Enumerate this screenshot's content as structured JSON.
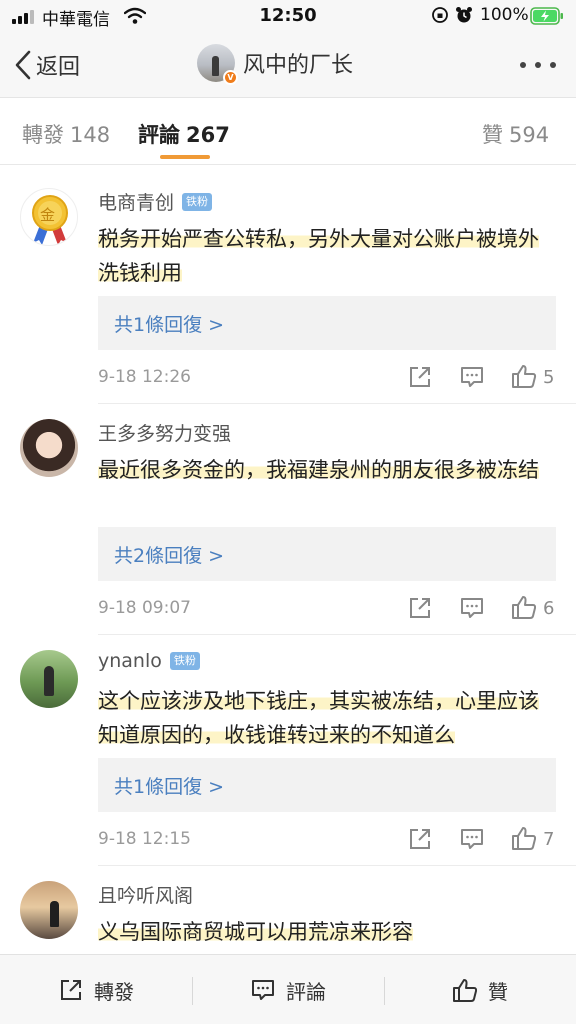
{
  "status_bar": {
    "carrier": "中華電信",
    "time": "12:50",
    "battery": "100%"
  },
  "nav": {
    "back_label": "返回",
    "title": "风中的厂长",
    "verified_mark": "V"
  },
  "tabs": [
    {
      "label": "轉發",
      "count": "148"
    },
    {
      "label": "評論",
      "count": "267"
    },
    {
      "label": "贊",
      "count": "594"
    }
  ],
  "comments": [
    {
      "author": "电商青创",
      "badge": "铁粉",
      "avatar_text": "金",
      "text": "税务开始严查公转私，另外大量对公账户被境外洗钱利用",
      "replies": "共1條回復 >",
      "time": "9-18 12:26",
      "likes": "5"
    },
    {
      "author": "王多多努力变强",
      "badge": "",
      "text": "最近很多资金的，我福建泉州的朋友很多被冻结",
      "replies": "共2條回復 >",
      "time": "9-18 09:07",
      "likes": "6"
    },
    {
      "author": "ynanlo",
      "badge": "铁粉",
      "text": "这个应该涉及地下钱庄，其实被冻结，心里应该知道原因的，收钱谁转过来的不知道么",
      "replies": "共1條回復 >",
      "time": "9-18 12:15",
      "likes": "7"
    },
    {
      "author": "且吟听风阁",
      "badge": "",
      "text": "义乌国际商贸城可以用荒凉来形容"
    }
  ],
  "bottom_bar": {
    "repost": "轉發",
    "comment": "評論",
    "like": "贊"
  },
  "colors": {
    "tab_underline": "#f09a36",
    "link": "#4a7fbf",
    "badge": "#7fb4e6",
    "highlight": "#fdf4c7"
  }
}
